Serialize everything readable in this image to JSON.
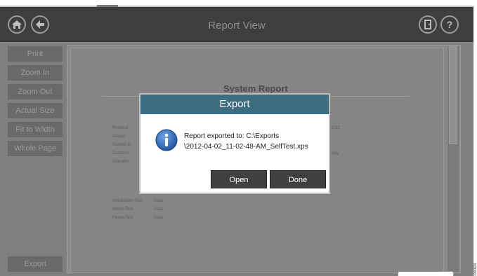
{
  "window": {
    "title": "Report View"
  },
  "sidebar": {
    "items": [
      {
        "label": "Print"
      },
      {
        "label": "Zoom In"
      },
      {
        "label": "Zoom Out"
      },
      {
        "label": "Actual Size"
      },
      {
        "label": "Fit to Width"
      },
      {
        "label": "Whole Page"
      }
    ],
    "export_label": "Export"
  },
  "report": {
    "title": "System Report",
    "fields": [
      "Protocol:",
      "Status:",
      "Started at:",
      "Duration:",
      "Operator:"
    ],
    "right_fragments": [
      "CSC",
      "WN"
    ],
    "tests": [
      {
        "name": "InitializationTest:",
        "result": "Pass"
      },
      {
        "name": "MotionTest:",
        "result": "Pass"
      },
      {
        "name": "HeaterTest:",
        "result": "Pass"
      }
    ]
  },
  "dialog": {
    "title": "Export",
    "message_line1": "Report exported to: C:\\Exports",
    "message_line2": "\\2012-04-02_11-02-48-AM_SelfTest.xps",
    "open_label": "Open",
    "done_label": "Done"
  },
  "figure_id": "1000EN"
}
